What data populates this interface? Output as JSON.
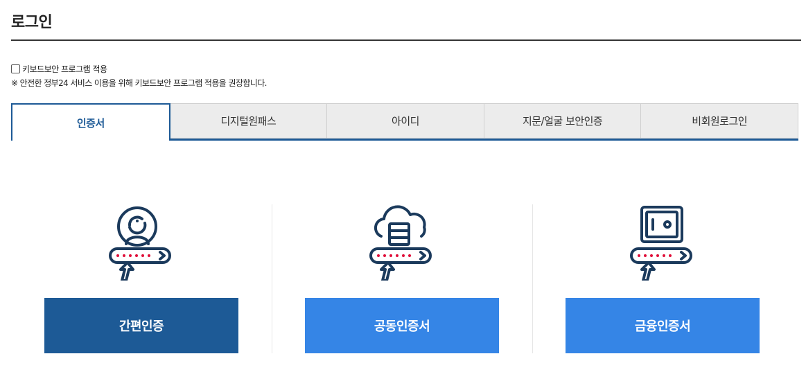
{
  "page": {
    "title": "로그인"
  },
  "keyboard_security": {
    "checkbox_label": "키보드보안 프로그램 적용",
    "checked": false,
    "note": "※ 안전한 정부24 서비스 이용을 위해 키보드보안 프로그램 적용을 권장합니다."
  },
  "tabs": [
    {
      "label": "인증서",
      "active": true
    },
    {
      "label": "디지털원패스",
      "active": false
    },
    {
      "label": "아이디",
      "active": false
    },
    {
      "label": "지문/얼굴 보안인증",
      "active": false
    },
    {
      "label": "비회원로그인",
      "active": false
    }
  ],
  "auth_options": [
    {
      "icon": "user-certificate-icon",
      "button_label": "간편인증"
    },
    {
      "icon": "cloud-server-certificate-icon",
      "button_label": "공동인증서"
    },
    {
      "icon": "safe-certificate-icon",
      "button_label": "금융인증서"
    }
  ],
  "colors": {
    "primary": "#1d5a96",
    "secondary_button": "#3585e6",
    "icon_stroke": "#1b3a5c",
    "password_dots": "#e0103a"
  }
}
